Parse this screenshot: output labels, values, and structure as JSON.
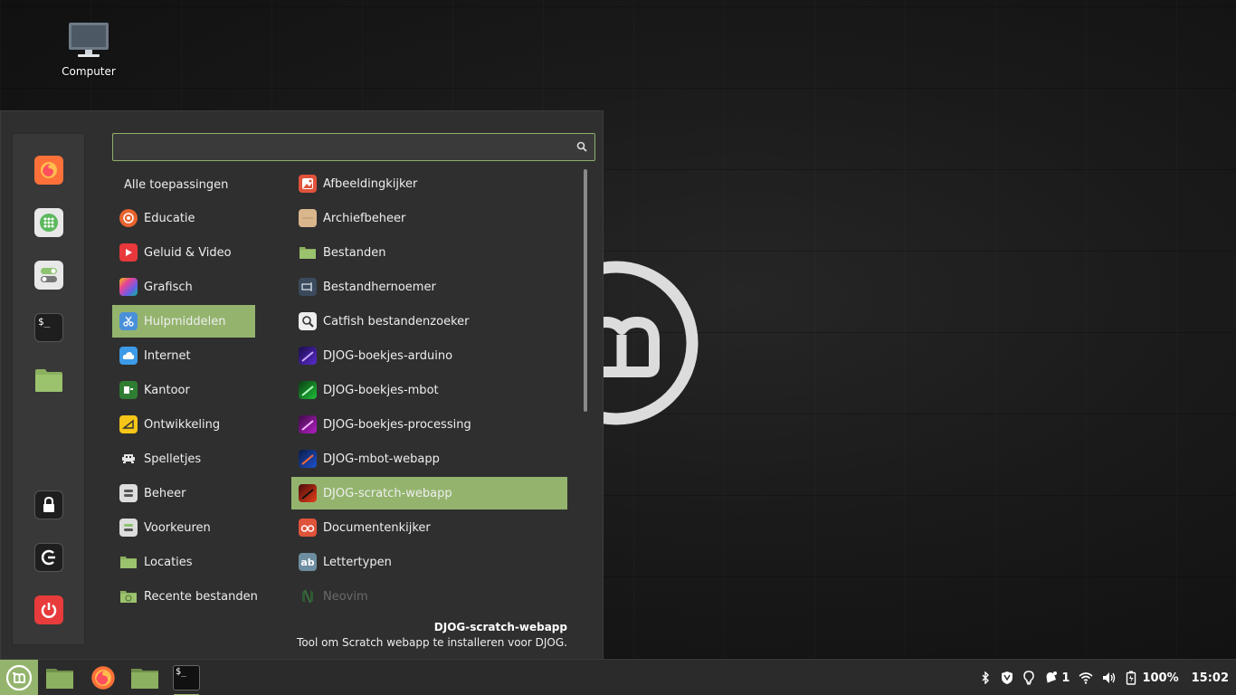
{
  "desktop": {
    "icons": [
      {
        "label": "Computer",
        "icon": "computer-icon"
      }
    ]
  },
  "favorites": [
    {
      "name": "firefox",
      "icon": "firefox-icon",
      "color": "#ff7139"
    },
    {
      "name": "software-manager",
      "icon": "grid-icon",
      "color": "#5cb85c"
    },
    {
      "name": "settings",
      "icon": "toggle-icon",
      "color": "#8dc26f"
    },
    {
      "name": "terminal",
      "icon": "terminal-icon",
      "color": "#222222"
    },
    {
      "name": "files",
      "icon": "folder-icon",
      "color": "#8bb05f"
    },
    {
      "name": "lock",
      "icon": "lock-icon",
      "color": "#222222"
    },
    {
      "name": "logout",
      "icon": "logout-icon",
      "color": "#222222"
    },
    {
      "name": "shutdown",
      "icon": "power-icon",
      "color": "#e83b3b"
    }
  ],
  "search": {
    "value": "",
    "placeholder": ""
  },
  "categories": {
    "all_label": "Alle toepassingen",
    "items": [
      {
        "label": "Educatie",
        "icon": "education-icon",
        "color": "#e8632f"
      },
      {
        "label": "Geluid & Video",
        "icon": "play-icon",
        "color": "#e8383b"
      },
      {
        "label": "Grafisch",
        "icon": "graphics-icon",
        "color": "#9b59b6"
      },
      {
        "label": "Hulpmiddelen",
        "icon": "scissors-icon",
        "color": "#4a90d9",
        "selected": true
      },
      {
        "label": "Internet",
        "icon": "cloud-icon",
        "color": "#3d9ae8"
      },
      {
        "label": "Kantoor",
        "icon": "office-icon",
        "color": "#2e7d32"
      },
      {
        "label": "Ontwikkeling",
        "icon": "development-icon",
        "color": "#f5c518"
      },
      {
        "label": "Spelletjes",
        "icon": "invader-icon",
        "color": "#444444"
      },
      {
        "label": "Beheer",
        "icon": "admin-icon",
        "color": "#dddddd"
      },
      {
        "label": "Voorkeuren",
        "icon": "preferences-icon",
        "color": "#dddddd"
      },
      {
        "label": "Locaties",
        "icon": "folder-icon",
        "color": "#8bb05f"
      },
      {
        "label": "Recente bestanden",
        "icon": "recent-folder-icon",
        "color": "#8bb05f"
      }
    ]
  },
  "apps": [
    {
      "label": "Afbeeldingkijker",
      "icon": "image-viewer-icon",
      "color": "#e0533b"
    },
    {
      "label": "Archiefbeheer",
      "icon": "archive-icon",
      "color": "#d9b68c"
    },
    {
      "label": "Bestanden",
      "icon": "folder-icon",
      "color": "#8bb05f"
    },
    {
      "label": "Bestandhernoemer",
      "icon": "renamer-icon",
      "color": "#3b4a5c"
    },
    {
      "label": "Catfish bestandenzoeker",
      "icon": "search-icon",
      "color": "#eeeeee"
    },
    {
      "label": "DJOG-boekjes-arduino",
      "icon": "djog-arduino-icon",
      "color": "#5b2bd0"
    },
    {
      "label": "DJOG-boekjes-mbot",
      "icon": "djog-mbot-icon",
      "color": "#1fbf3a"
    },
    {
      "label": "DJOG-boekjes-processing",
      "icon": "djog-processing-icon",
      "color": "#b61fc7"
    },
    {
      "label": "DJOG-mbot-webapp",
      "icon": "djog-webapp-icon",
      "color": "#1f52d0"
    },
    {
      "label": "DJOG-scratch-webapp",
      "icon": "djog-scratch-icon",
      "color": "#e8401a",
      "selected": true
    },
    {
      "label": "Documentenkijker",
      "icon": "document-viewer-icon",
      "color": "#e0533b"
    },
    {
      "label": "Lettertypen",
      "icon": "fonts-icon",
      "color": "#6d8ea0"
    },
    {
      "label": "Neovim",
      "icon": "neovim-icon",
      "color": "#3a5f3a",
      "dimmed": true
    }
  ],
  "description": {
    "title": "DJOG-scratch-webapp",
    "text": "Tool om Scratch webapp te installeren voor DJOG."
  },
  "taskbar": {
    "items": [
      {
        "name": "menu",
        "icon": "mint-icon"
      },
      {
        "name": "show-desktop",
        "icon": "desktop-folder-icon"
      },
      {
        "name": "firefox",
        "icon": "firefox-icon"
      },
      {
        "name": "files",
        "icon": "folder-icon"
      },
      {
        "name": "terminal",
        "icon": "terminal-icon",
        "active": true
      }
    ],
    "tray": {
      "notifications_count": "1",
      "battery": "100%",
      "clock": "15:02"
    }
  },
  "colors": {
    "accent": "#94b46e",
    "menu_bg": "#2f2f2f",
    "taskbar_bg": "#2b2b2b"
  }
}
